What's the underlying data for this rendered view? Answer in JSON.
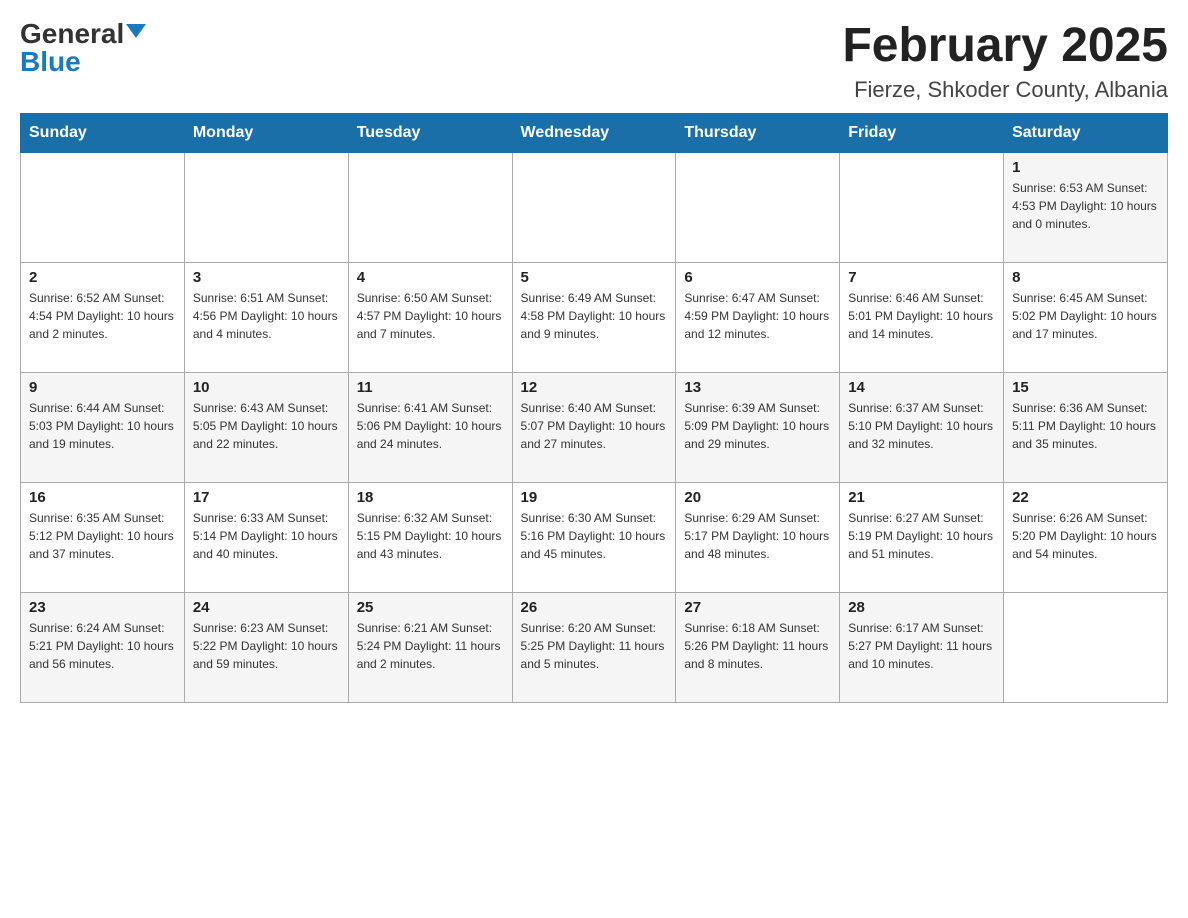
{
  "header": {
    "logo_general": "General",
    "logo_blue": "Blue",
    "month_title": "February 2025",
    "location": "Fierze, Shkoder County, Albania"
  },
  "days_of_week": [
    "Sunday",
    "Monday",
    "Tuesday",
    "Wednesday",
    "Thursday",
    "Friday",
    "Saturday"
  ],
  "weeks": [
    [
      {
        "day": "",
        "info": ""
      },
      {
        "day": "",
        "info": ""
      },
      {
        "day": "",
        "info": ""
      },
      {
        "day": "",
        "info": ""
      },
      {
        "day": "",
        "info": ""
      },
      {
        "day": "",
        "info": ""
      },
      {
        "day": "1",
        "info": "Sunrise: 6:53 AM\nSunset: 4:53 PM\nDaylight: 10 hours and 0 minutes."
      }
    ],
    [
      {
        "day": "2",
        "info": "Sunrise: 6:52 AM\nSunset: 4:54 PM\nDaylight: 10 hours and 2 minutes."
      },
      {
        "day": "3",
        "info": "Sunrise: 6:51 AM\nSunset: 4:56 PM\nDaylight: 10 hours and 4 minutes."
      },
      {
        "day": "4",
        "info": "Sunrise: 6:50 AM\nSunset: 4:57 PM\nDaylight: 10 hours and 7 minutes."
      },
      {
        "day": "5",
        "info": "Sunrise: 6:49 AM\nSunset: 4:58 PM\nDaylight: 10 hours and 9 minutes."
      },
      {
        "day": "6",
        "info": "Sunrise: 6:47 AM\nSunset: 4:59 PM\nDaylight: 10 hours and 12 minutes."
      },
      {
        "day": "7",
        "info": "Sunrise: 6:46 AM\nSunset: 5:01 PM\nDaylight: 10 hours and 14 minutes."
      },
      {
        "day": "8",
        "info": "Sunrise: 6:45 AM\nSunset: 5:02 PM\nDaylight: 10 hours and 17 minutes."
      }
    ],
    [
      {
        "day": "9",
        "info": "Sunrise: 6:44 AM\nSunset: 5:03 PM\nDaylight: 10 hours and 19 minutes."
      },
      {
        "day": "10",
        "info": "Sunrise: 6:43 AM\nSunset: 5:05 PM\nDaylight: 10 hours and 22 minutes."
      },
      {
        "day": "11",
        "info": "Sunrise: 6:41 AM\nSunset: 5:06 PM\nDaylight: 10 hours and 24 minutes."
      },
      {
        "day": "12",
        "info": "Sunrise: 6:40 AM\nSunset: 5:07 PM\nDaylight: 10 hours and 27 minutes."
      },
      {
        "day": "13",
        "info": "Sunrise: 6:39 AM\nSunset: 5:09 PM\nDaylight: 10 hours and 29 minutes."
      },
      {
        "day": "14",
        "info": "Sunrise: 6:37 AM\nSunset: 5:10 PM\nDaylight: 10 hours and 32 minutes."
      },
      {
        "day": "15",
        "info": "Sunrise: 6:36 AM\nSunset: 5:11 PM\nDaylight: 10 hours and 35 minutes."
      }
    ],
    [
      {
        "day": "16",
        "info": "Sunrise: 6:35 AM\nSunset: 5:12 PM\nDaylight: 10 hours and 37 minutes."
      },
      {
        "day": "17",
        "info": "Sunrise: 6:33 AM\nSunset: 5:14 PM\nDaylight: 10 hours and 40 minutes."
      },
      {
        "day": "18",
        "info": "Sunrise: 6:32 AM\nSunset: 5:15 PM\nDaylight: 10 hours and 43 minutes."
      },
      {
        "day": "19",
        "info": "Sunrise: 6:30 AM\nSunset: 5:16 PM\nDaylight: 10 hours and 45 minutes."
      },
      {
        "day": "20",
        "info": "Sunrise: 6:29 AM\nSunset: 5:17 PM\nDaylight: 10 hours and 48 minutes."
      },
      {
        "day": "21",
        "info": "Sunrise: 6:27 AM\nSunset: 5:19 PM\nDaylight: 10 hours and 51 minutes."
      },
      {
        "day": "22",
        "info": "Sunrise: 6:26 AM\nSunset: 5:20 PM\nDaylight: 10 hours and 54 minutes."
      }
    ],
    [
      {
        "day": "23",
        "info": "Sunrise: 6:24 AM\nSunset: 5:21 PM\nDaylight: 10 hours and 56 minutes."
      },
      {
        "day": "24",
        "info": "Sunrise: 6:23 AM\nSunset: 5:22 PM\nDaylight: 10 hours and 59 minutes."
      },
      {
        "day": "25",
        "info": "Sunrise: 6:21 AM\nSunset: 5:24 PM\nDaylight: 11 hours and 2 minutes."
      },
      {
        "day": "26",
        "info": "Sunrise: 6:20 AM\nSunset: 5:25 PM\nDaylight: 11 hours and 5 minutes."
      },
      {
        "day": "27",
        "info": "Sunrise: 6:18 AM\nSunset: 5:26 PM\nDaylight: 11 hours and 8 minutes."
      },
      {
        "day": "28",
        "info": "Sunrise: 6:17 AM\nSunset: 5:27 PM\nDaylight: 11 hours and 10 minutes."
      },
      {
        "day": "",
        "info": ""
      }
    ]
  ]
}
